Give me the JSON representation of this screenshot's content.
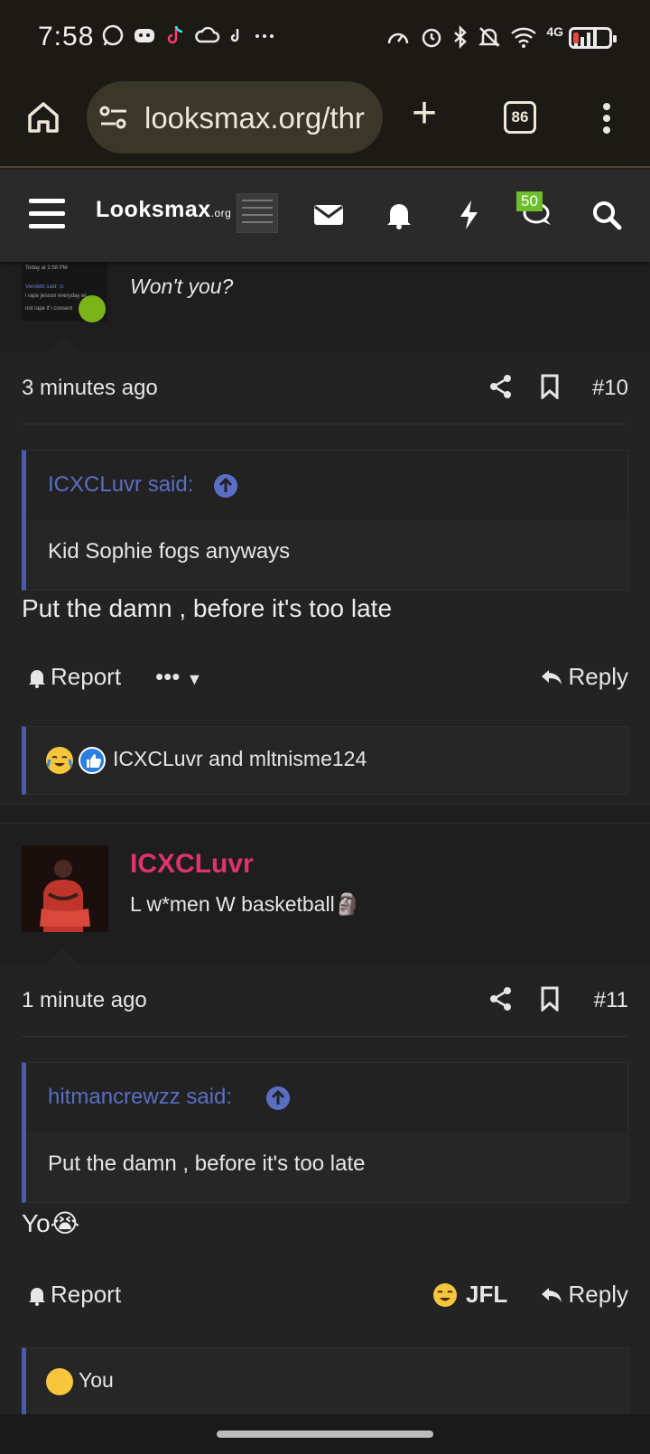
{
  "status_bar": {
    "time": "7:58",
    "left_icons": [
      "whatsapp-icon",
      "discord-icon",
      "tiktok-icon",
      "cloud-icon",
      "tiktok-icon",
      "more-icon"
    ],
    "right_icons": [
      "speed-icon",
      "alarm-icon",
      "bluetooth-icon",
      "mute-icon",
      "wifi-icon",
      "network-4g-icon",
      "signal-icon",
      "battery-icon"
    ],
    "network": "4G"
  },
  "browser": {
    "url": "looksmax.org/thr",
    "tab_count": "86"
  },
  "site_nav": {
    "logo": "Looksmax",
    "logo_suffix": ".org",
    "conversations_badge": "50"
  },
  "posts": [
    {
      "partial_text": "Won't you?",
      "time": "3 minutes ago",
      "number": "#10",
      "quote": {
        "author": "ICXCLuvr said:",
        "text": "Kid Sophie fogs anyways"
      },
      "message": "Put the damn , before it's too late",
      "actions": {
        "report": "Report",
        "more": "•••",
        "reply": "Reply"
      },
      "reactions": "ICXCLuvr and mltnisme124"
    },
    {
      "username": "ICXCLuvr",
      "user_title": "L w*men W basketball🗿",
      "time": "1 minute ago",
      "number": "#11",
      "quote": {
        "author": "hitmancrewzz said:",
        "text": "Put the damn , before it's too late"
      },
      "message": "Yo😭",
      "actions": {
        "report": "Report",
        "jfl": "JFL",
        "reply": "Reply"
      },
      "reactions_partial": "You"
    }
  ],
  "colors": {
    "accent_blue": "#4a5cb0",
    "username_pink": "#e0336e",
    "badge_green": "#6cbf2a"
  }
}
